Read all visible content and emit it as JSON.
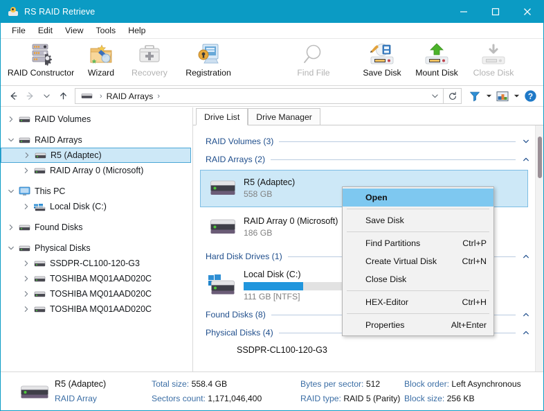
{
  "window": {
    "title": "RS RAID Retrieve",
    "app_icon": "app-logo-icon",
    "minimize": "minimize-icon",
    "maximize": "maximize-icon",
    "close": "close-icon",
    "accent_color": "#0b9bc4"
  },
  "menubar": {
    "items": [
      {
        "label": "File"
      },
      {
        "label": "Edit"
      },
      {
        "label": "View"
      },
      {
        "label": "Tools"
      },
      {
        "label": "Help"
      }
    ]
  },
  "toolbar": {
    "items": [
      {
        "label": "RAID Constructor",
        "icon": "raid-constructor-icon",
        "disabled": false
      },
      {
        "label": "Wizard",
        "icon": "wizard-icon",
        "disabled": false
      },
      {
        "label": "Recovery",
        "icon": "recovery-icon",
        "disabled": true
      },
      {
        "label": "Registration",
        "icon": "registration-icon",
        "disabled": false
      },
      {
        "label": "Find File",
        "icon": "find-file-icon",
        "disabled": true
      },
      {
        "label": "Save Disk",
        "icon": "save-disk-icon",
        "disabled": false
      },
      {
        "label": "Mount Disk",
        "icon": "mount-disk-icon",
        "disabled": false
      },
      {
        "label": "Close Disk",
        "icon": "close-disk-icon",
        "disabled": true
      }
    ]
  },
  "addressbar": {
    "back": "back-arrow-icon",
    "forward": "forward-arrow-icon",
    "history": "history-dropdown-icon",
    "up": "up-arrow-icon",
    "root_icon": "drive-icon",
    "path": "RAID Arrays",
    "separator": "›",
    "dropdown": "chevron-down-icon",
    "refresh": "refresh-icon",
    "filter": "filter-icon",
    "filter_caret": "chevron-down-icon",
    "view": "view-mode-icon",
    "view_caret": "chevron-down-icon",
    "help": "help-icon"
  },
  "sidebar": {
    "items": [
      {
        "label": "RAID Volumes",
        "level": 1,
        "chevron": "chevron-right-icon",
        "icon": "drive-icon",
        "selected": false,
        "gap_before": false
      },
      {
        "label": "RAID Arrays",
        "level": 1,
        "chevron": "chevron-down-icon",
        "icon": "drive-icon",
        "selected": false,
        "gap_before": true
      },
      {
        "label": "R5 (Adaptec)",
        "level": 2,
        "chevron": "chevron-right-icon",
        "icon": "drive-icon",
        "selected": true,
        "gap_before": false
      },
      {
        "label": "RAID Array 0 (Microsoft)",
        "level": 2,
        "chevron": "chevron-right-icon",
        "icon": "drive-icon",
        "selected": false,
        "gap_before": false
      },
      {
        "label": "This PC",
        "level": 1,
        "chevron": "chevron-down-icon",
        "icon": "monitor-icon",
        "selected": false,
        "gap_before": true
      },
      {
        "label": "Local Disk (C:)",
        "level": 2,
        "chevron": "chevron-right-icon",
        "icon": "windows-drive-icon",
        "selected": false,
        "gap_before": false
      },
      {
        "label": "Found Disks",
        "level": 1,
        "chevron": "chevron-right-icon",
        "icon": "drive-icon",
        "selected": false,
        "gap_before": true
      },
      {
        "label": "Physical Disks",
        "level": 1,
        "chevron": "chevron-down-icon",
        "icon": "drive-icon",
        "selected": false,
        "gap_before": true
      },
      {
        "label": "SSDPR-CL100-120-G3",
        "level": 2,
        "chevron": "chevron-right-icon",
        "icon": "drive-icon",
        "selected": false,
        "gap_before": false
      },
      {
        "label": "TOSHIBA MQ01AAD020C",
        "level": 2,
        "chevron": "chevron-right-icon",
        "icon": "drive-icon",
        "selected": false,
        "gap_before": false
      },
      {
        "label": "TOSHIBA MQ01AAD020C",
        "level": 2,
        "chevron": "chevron-right-icon",
        "icon": "drive-icon",
        "selected": false,
        "gap_before": false
      },
      {
        "label": "TOSHIBA MQ01AAD020C",
        "level": 2,
        "chevron": "chevron-right-icon",
        "icon": "drive-icon",
        "selected": false,
        "gap_before": false
      }
    ]
  },
  "main": {
    "tabs": [
      {
        "label": "Drive List",
        "active": true
      },
      {
        "label": "Drive Manager",
        "active": false
      }
    ],
    "sections": [
      {
        "label": "RAID Volumes (3)",
        "collapsed": true,
        "chevron": "chevron-down-icon",
        "drives": []
      },
      {
        "label": "RAID Arrays (2)",
        "collapsed": false,
        "chevron": "chevron-up-icon",
        "drives": [
          {
            "name": "R5 (Adaptec)",
            "size": "558 GB",
            "icon": "raid-disk-icon",
            "selected": true,
            "has_bar": false,
            "bar_percent": 0
          },
          {
            "name": "RAID Array 0 (Microsoft)",
            "size": "186 GB",
            "icon": "raid-disk-icon",
            "selected": false,
            "has_bar": false,
            "bar_percent": 0
          }
        ]
      },
      {
        "label": "Hard Disk Drives (1)",
        "collapsed": false,
        "chevron": "chevron-up-icon",
        "drives": [
          {
            "name": "Local Disk (C:)",
            "size": "111 GB [NTFS]",
            "icon": "windows-disk-icon",
            "selected": false,
            "has_bar": true,
            "bar_percent": 43
          }
        ]
      },
      {
        "label": "Found Disks (8)",
        "collapsed": true,
        "chevron": "chevron-up-icon",
        "drives": []
      },
      {
        "label": "Physical Disks (4)",
        "collapsed": false,
        "chevron": "chevron-up-icon",
        "drives": [
          {
            "name": "SSDPR-CL100-120-G3",
            "size": "",
            "icon": "raid-disk-icon",
            "selected": false,
            "has_bar": false,
            "bar_percent": 0
          }
        ]
      }
    ]
  },
  "context_menu": {
    "items": [
      {
        "label": "Open",
        "accel": "",
        "highlighted": true,
        "sep_after": true
      },
      {
        "label": "Save Disk",
        "accel": "",
        "highlighted": false,
        "sep_after": true
      },
      {
        "label": "Find Partitions",
        "accel": "Ctrl+P",
        "highlighted": false,
        "sep_after": false
      },
      {
        "label": "Create Virtual Disk",
        "accel": "Ctrl+N",
        "highlighted": false,
        "sep_after": false
      },
      {
        "label": "Close Disk",
        "accel": "",
        "highlighted": false,
        "sep_after": true
      },
      {
        "label": "HEX-Editor",
        "accel": "Ctrl+H",
        "highlighted": false,
        "sep_after": true
      },
      {
        "label": "Properties",
        "accel": "Alt+Enter",
        "highlighted": false,
        "sep_after": false
      }
    ]
  },
  "statusbar": {
    "icon": "raid-disk-icon",
    "name": "R5 (Adaptec)",
    "type": "RAID Array",
    "fields": [
      {
        "label": "Total size:",
        "value": "558.4 GB"
      },
      {
        "label": "Sectors count:",
        "value": "1,171,046,400"
      },
      {
        "label": "Bytes per sector:",
        "value": "512"
      },
      {
        "label": "RAID type:",
        "value": "RAID 5 (Parity)"
      },
      {
        "label": "Block order:",
        "value": "Left Asynchronous"
      },
      {
        "label": "Block size:",
        "value": "256 KB"
      }
    ]
  }
}
